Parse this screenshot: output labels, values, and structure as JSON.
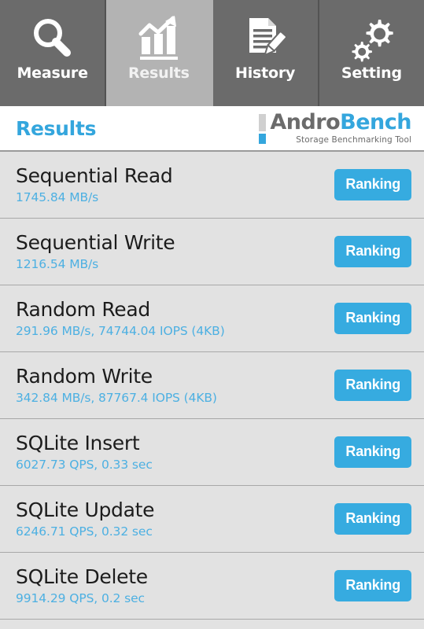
{
  "colors": {
    "accent_blue": "#34a6dd",
    "button_blue": "#36abe0",
    "subtext_blue": "#4db0e2",
    "tabbar_gray": "#6b6b6b",
    "tab_active_gray": "#b3b3b3",
    "content_gray": "#e2e2e2"
  },
  "tabbar": {
    "tabs": [
      {
        "label": "Measure",
        "icon": "magnifier-icon",
        "active": false
      },
      {
        "label": "Results",
        "icon": "bar-chart-icon",
        "active": true
      },
      {
        "label": "History",
        "icon": "document-pencil-icon",
        "active": false
      },
      {
        "label": "Setting",
        "icon": "gears-icon",
        "active": false
      }
    ]
  },
  "header": {
    "title": "Results",
    "logo": {
      "name_part1": "Andro",
      "name_part2": "Bench",
      "tagline": "Storage Benchmarking Tool"
    }
  },
  "results": {
    "ranking_label": "Ranking",
    "rows": [
      {
        "title": "Sequential Read",
        "value": "1745.84 MB/s"
      },
      {
        "title": "Sequential Write",
        "value": "1216.54 MB/s"
      },
      {
        "title": "Random Read",
        "value": "291.96 MB/s, 74744.04 IOPS (4KB)"
      },
      {
        "title": "Random Write",
        "value": "342.84 MB/s, 87767.4 IOPS (4KB)"
      },
      {
        "title": "SQLite Insert",
        "value": "6027.73 QPS, 0.33 sec"
      },
      {
        "title": "SQLite Update",
        "value": "6246.71 QPS, 0.32 sec"
      },
      {
        "title": "SQLite Delete",
        "value": "9914.29 QPS, 0.2 sec"
      }
    ]
  }
}
